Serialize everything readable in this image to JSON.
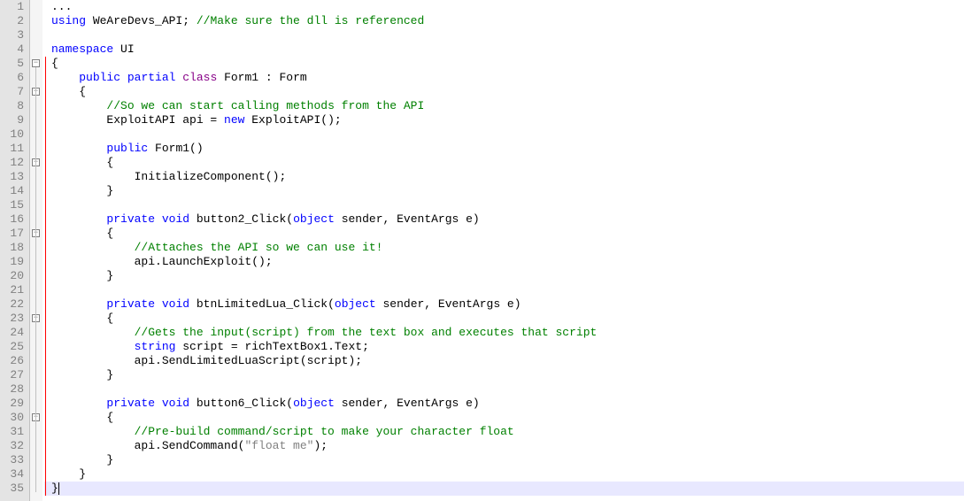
{
  "lines": [
    {
      "n": 1,
      "fold": null,
      "tokens": [
        [
          "txt",
          "..."
        ]
      ]
    },
    {
      "n": 2,
      "fold": null,
      "tokens": [
        [
          "kw",
          "using"
        ],
        [
          "txt",
          " WeAreDevs_API; "
        ],
        [
          "com",
          "//Make sure the dll is referenced"
        ]
      ]
    },
    {
      "n": 3,
      "fold": null,
      "tokens": []
    },
    {
      "n": 4,
      "fold": null,
      "tokens": [
        [
          "kw",
          "namespace"
        ],
        [
          "txt",
          " UI"
        ]
      ]
    },
    {
      "n": 5,
      "fold": "minus",
      "tokens": [
        [
          "txt",
          "{"
        ]
      ]
    },
    {
      "n": 6,
      "fold": null,
      "tokens": [
        [
          "txt",
          "    "
        ],
        [
          "kw",
          "public"
        ],
        [
          "txt",
          " "
        ],
        [
          "kw",
          "partial"
        ],
        [
          "txt",
          " "
        ],
        [
          "cls",
          "class"
        ],
        [
          "txt",
          " Form1 : Form"
        ]
      ]
    },
    {
      "n": 7,
      "fold": "minus",
      "tokens": [
        [
          "txt",
          "    {"
        ]
      ]
    },
    {
      "n": 8,
      "fold": null,
      "tokens": [
        [
          "txt",
          "        "
        ],
        [
          "com",
          "//So we can start calling methods from the API"
        ]
      ]
    },
    {
      "n": 9,
      "fold": null,
      "tokens": [
        [
          "txt",
          "        ExploitAPI api = "
        ],
        [
          "kw",
          "new"
        ],
        [
          "txt",
          " ExploitAPI();"
        ]
      ]
    },
    {
      "n": 10,
      "fold": null,
      "tokens": []
    },
    {
      "n": 11,
      "fold": null,
      "tokens": [
        [
          "txt",
          "        "
        ],
        [
          "kw",
          "public"
        ],
        [
          "txt",
          " Form1()"
        ]
      ]
    },
    {
      "n": 12,
      "fold": "minus",
      "tokens": [
        [
          "txt",
          "        {"
        ]
      ]
    },
    {
      "n": 13,
      "fold": null,
      "tokens": [
        [
          "txt",
          "            InitializeComponent();"
        ]
      ]
    },
    {
      "n": 14,
      "fold": null,
      "tokens": [
        [
          "txt",
          "        }"
        ]
      ]
    },
    {
      "n": 15,
      "fold": null,
      "tokens": []
    },
    {
      "n": 16,
      "fold": null,
      "tokens": [
        [
          "txt",
          "        "
        ],
        [
          "kw",
          "private"
        ],
        [
          "txt",
          " "
        ],
        [
          "kw",
          "void"
        ],
        [
          "txt",
          " button2_Click("
        ],
        [
          "kw",
          "object"
        ],
        [
          "txt",
          " sender, EventArgs e)"
        ]
      ]
    },
    {
      "n": 17,
      "fold": "minus",
      "tokens": [
        [
          "txt",
          "        {"
        ]
      ]
    },
    {
      "n": 18,
      "fold": null,
      "tokens": [
        [
          "txt",
          "            "
        ],
        [
          "com",
          "//Attaches the API so we can use it!"
        ]
      ]
    },
    {
      "n": 19,
      "fold": null,
      "tokens": [
        [
          "txt",
          "            api.LaunchExploit();"
        ]
      ]
    },
    {
      "n": 20,
      "fold": null,
      "tokens": [
        [
          "txt",
          "        }"
        ]
      ]
    },
    {
      "n": 21,
      "fold": null,
      "tokens": []
    },
    {
      "n": 22,
      "fold": null,
      "tokens": [
        [
          "txt",
          "        "
        ],
        [
          "kw",
          "private"
        ],
        [
          "txt",
          " "
        ],
        [
          "kw",
          "void"
        ],
        [
          "txt",
          " btnLimitedLua_Click("
        ],
        [
          "kw",
          "object"
        ],
        [
          "txt",
          " sender, EventArgs e)"
        ]
      ]
    },
    {
      "n": 23,
      "fold": "minus",
      "tokens": [
        [
          "txt",
          "        {"
        ]
      ]
    },
    {
      "n": 24,
      "fold": null,
      "tokens": [
        [
          "txt",
          "            "
        ],
        [
          "com",
          "//Gets the input(script) from the text box and executes that script"
        ]
      ]
    },
    {
      "n": 25,
      "fold": null,
      "tokens": [
        [
          "txt",
          "            "
        ],
        [
          "kw",
          "string"
        ],
        [
          "txt",
          " script = richTextBox1.Text;"
        ]
      ]
    },
    {
      "n": 26,
      "fold": null,
      "tokens": [
        [
          "txt",
          "            api.SendLimitedLuaScript(script);"
        ]
      ]
    },
    {
      "n": 27,
      "fold": null,
      "tokens": [
        [
          "txt",
          "        }"
        ]
      ]
    },
    {
      "n": 28,
      "fold": null,
      "tokens": []
    },
    {
      "n": 29,
      "fold": null,
      "tokens": [
        [
          "txt",
          "        "
        ],
        [
          "kw",
          "private"
        ],
        [
          "txt",
          " "
        ],
        [
          "kw",
          "void"
        ],
        [
          "txt",
          " button6_Click("
        ],
        [
          "kw",
          "object"
        ],
        [
          "txt",
          " sender, EventArgs e)"
        ]
      ]
    },
    {
      "n": 30,
      "fold": "minus",
      "tokens": [
        [
          "txt",
          "        {"
        ]
      ]
    },
    {
      "n": 31,
      "fold": null,
      "tokens": [
        [
          "txt",
          "            "
        ],
        [
          "com",
          "//Pre-build command/script to make your character float"
        ]
      ]
    },
    {
      "n": 32,
      "fold": null,
      "tokens": [
        [
          "txt",
          "            api.SendCommand("
        ],
        [
          "str",
          "\"float me\""
        ],
        [
          "txt",
          ");"
        ]
      ]
    },
    {
      "n": 33,
      "fold": null,
      "tokens": [
        [
          "txt",
          "        }"
        ]
      ]
    },
    {
      "n": 34,
      "fold": null,
      "tokens": [
        [
          "txt",
          "    }"
        ]
      ]
    },
    {
      "n": 35,
      "fold": null,
      "hl": true,
      "caret": true,
      "tokens": [
        [
          "txt",
          "}"
        ]
      ]
    }
  ],
  "fold_glyph": "−"
}
